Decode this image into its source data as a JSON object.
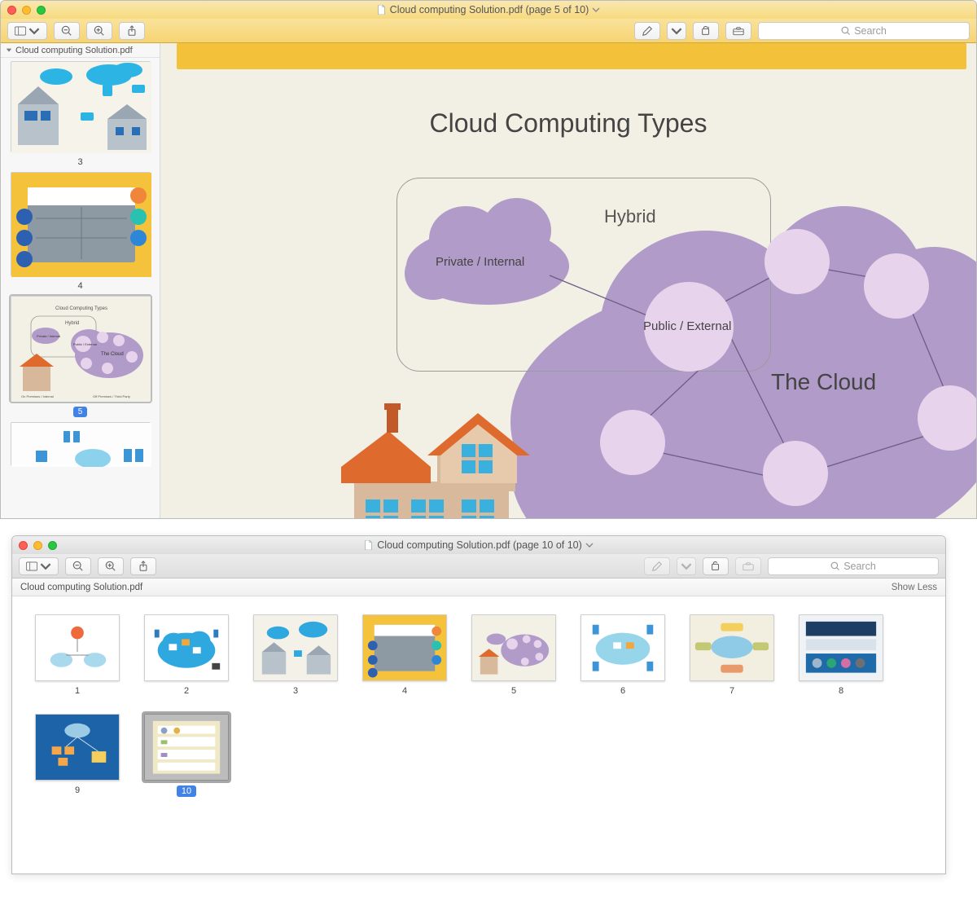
{
  "win1": {
    "title_prefix": "Cloud computing Solution.pdf",
    "title_suffix": "(page 5 of 10)",
    "sidebar_filename": "Cloud computing Solution.pdf",
    "search_placeholder": "Search",
    "thumbs": {
      "t3": "3",
      "t4": "4",
      "t5": "5"
    },
    "page": {
      "title": "Cloud Computing Types",
      "hybrid": "Hybrid",
      "private": "Private / Internal",
      "public": "Public / External",
      "thecloud": "The Cloud"
    }
  },
  "win2": {
    "title_prefix": "Cloud computing Solution.pdf",
    "title_suffix": "(page 10 of 10)",
    "subbar_filename": "Cloud computing Solution.pdf",
    "showless": "Show Less",
    "search_placeholder": "Search",
    "labels": [
      "1",
      "2",
      "3",
      "4",
      "5",
      "6",
      "7",
      "8",
      "9",
      "10"
    ]
  }
}
